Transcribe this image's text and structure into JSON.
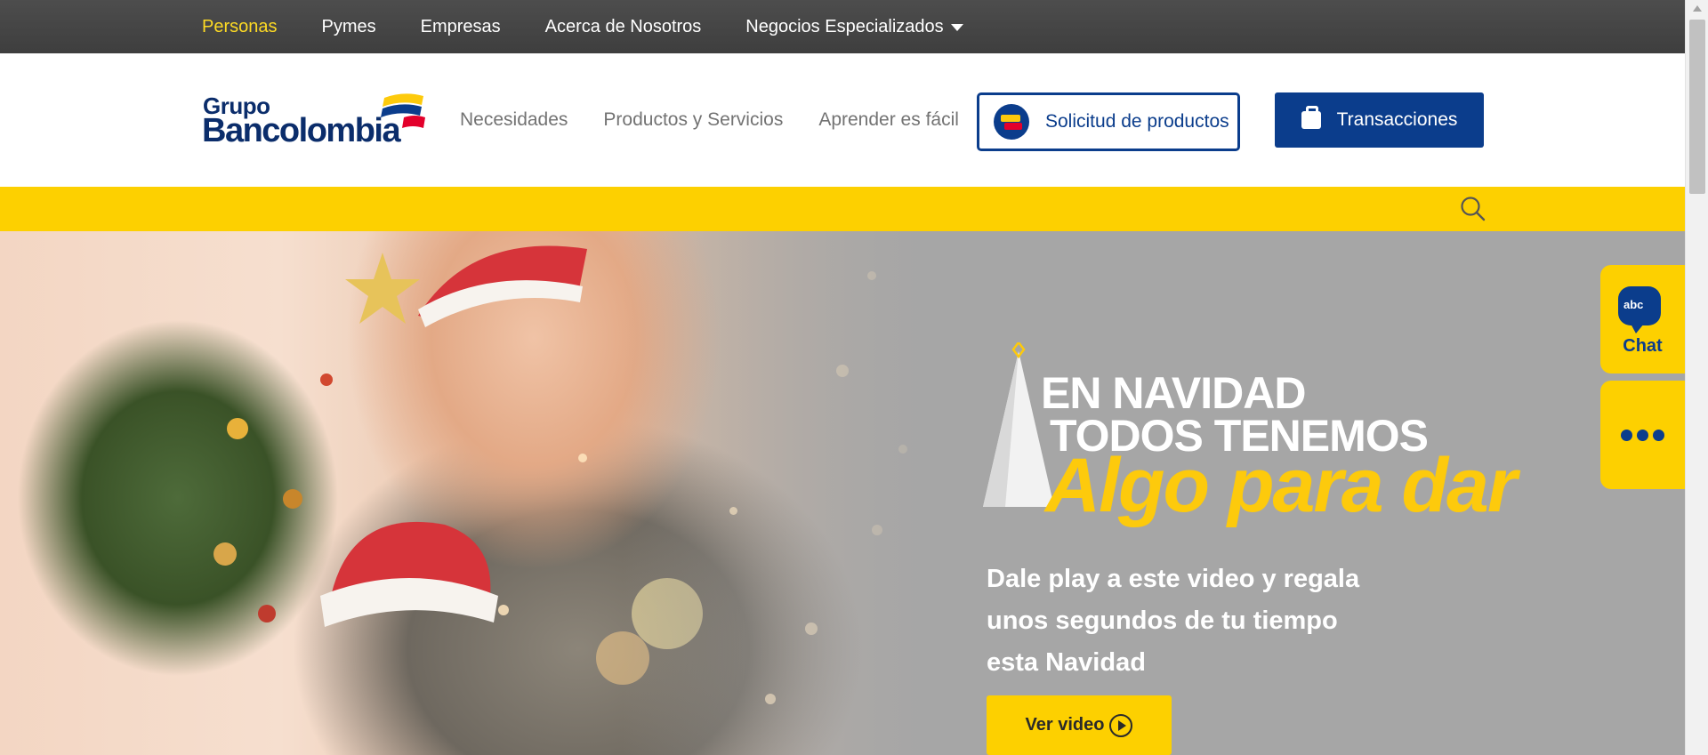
{
  "topnav": {
    "items": [
      {
        "label": "Personas",
        "active": true
      },
      {
        "label": "Pymes"
      },
      {
        "label": "Empresas"
      },
      {
        "label": "Acerca de Nosotros"
      },
      {
        "label": "Negocios Especializados",
        "has_dropdown": true
      }
    ]
  },
  "header": {
    "logo_line1": "Grupo",
    "logo_line2": "Bancolombia",
    "nav": [
      "Necesidades",
      "Productos y Servicios",
      "Aprender es fácil"
    ],
    "solicitud_label": "Solicitud de productos",
    "transacciones_label": "Transacciones"
  },
  "searchbar": {
    "icon": "search-icon"
  },
  "hero": {
    "headline_line1": "EN NAVIDAD",
    "headline_line2": "TODOS TENEMOS",
    "headline_line3": "Algo para dar",
    "description": "Dale play a este video y regala unos segundos de tu tiempo esta Navidad",
    "button_label": "Ver video"
  },
  "side_widgets": {
    "chat_badge": "abc",
    "chat_label": "Chat",
    "more_icon": "more-dots-icon"
  },
  "colors": {
    "brand_blue": "#0b3d8c",
    "brand_yellow": "#fdd000",
    "topbar": "#474747",
    "hero_gray": "#a6a6a6"
  }
}
